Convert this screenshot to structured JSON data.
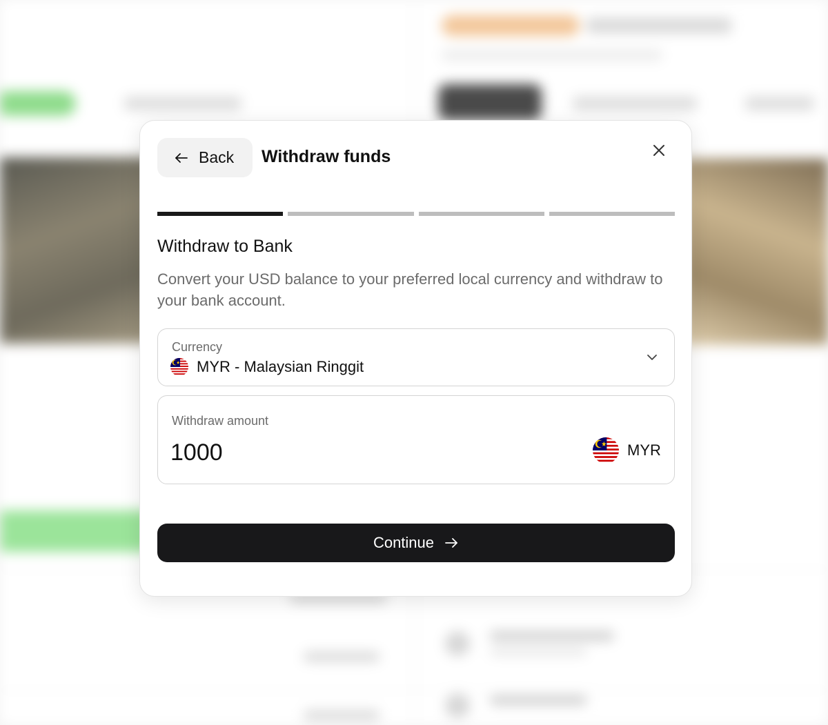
{
  "modal": {
    "back_label": "Back",
    "title": "Withdraw funds",
    "steps": {
      "total": 4,
      "current": 1
    },
    "section_title": "Withdraw to Bank",
    "section_description": "Convert your USD balance to your preferred local currency and withdraw to your bank account.",
    "currency": {
      "label": "Currency",
      "value": "MYR - Malaysian Ringgit",
      "flag": "malaysia-flag"
    },
    "amount": {
      "label": "Withdraw amount",
      "value": "1000",
      "currency_code": "MYR",
      "flag": "malaysia-flag"
    },
    "continue_label": "Continue"
  },
  "colors": {
    "primary_button": "#18181a",
    "step_active": "#1a1a1a",
    "step_inactive": "#bdbdbd"
  }
}
